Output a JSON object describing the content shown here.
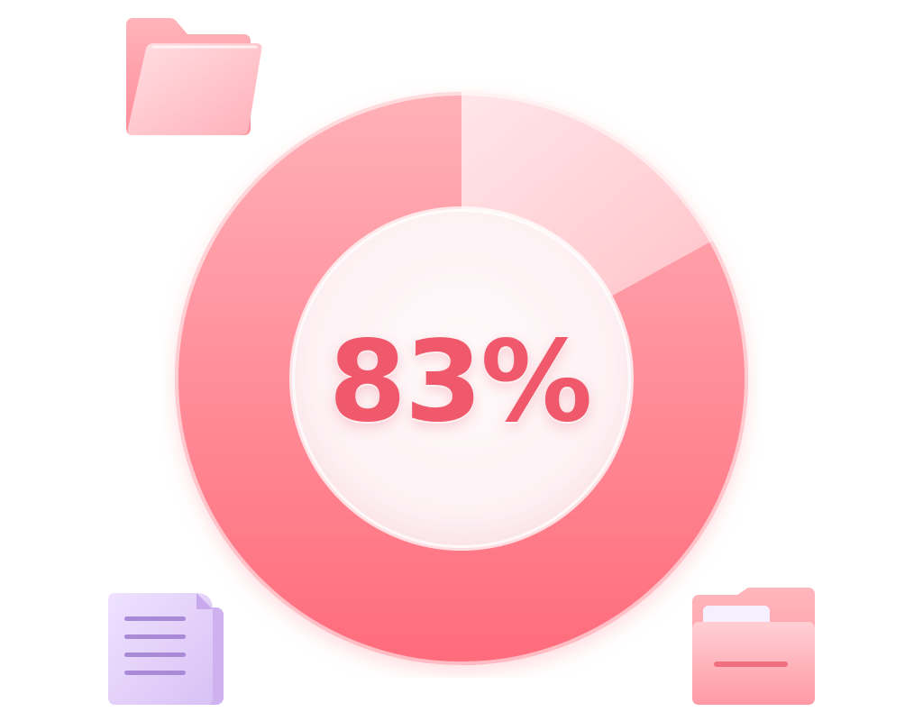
{
  "chart_data": {
    "type": "pie",
    "variant": "donut",
    "center_label": "83%",
    "value_percent": 83,
    "start_at": "12 o'clock",
    "direction": "counterclockwise",
    "slices": [
      {
        "value": 83,
        "color": "#ff7b88"
      },
      {
        "value": 17,
        "color": "#ffd3d8"
      }
    ],
    "legend": "none",
    "grid": false
  },
  "colors": {
    "accent": "#f0596b",
    "filled_light": "#ffb1b8",
    "filled_dark": "#ff6b7b",
    "remainder_light": "#ffe6e9",
    "remainder_dark": "#ffc4ca",
    "hole": "#fdf1f4",
    "document": "#dcc6f5",
    "folder": "#ffb6bd"
  },
  "decorations": [
    {
      "icon": "folder-icon"
    },
    {
      "icon": "document-icon"
    },
    {
      "icon": "open-folder-icon"
    }
  ]
}
